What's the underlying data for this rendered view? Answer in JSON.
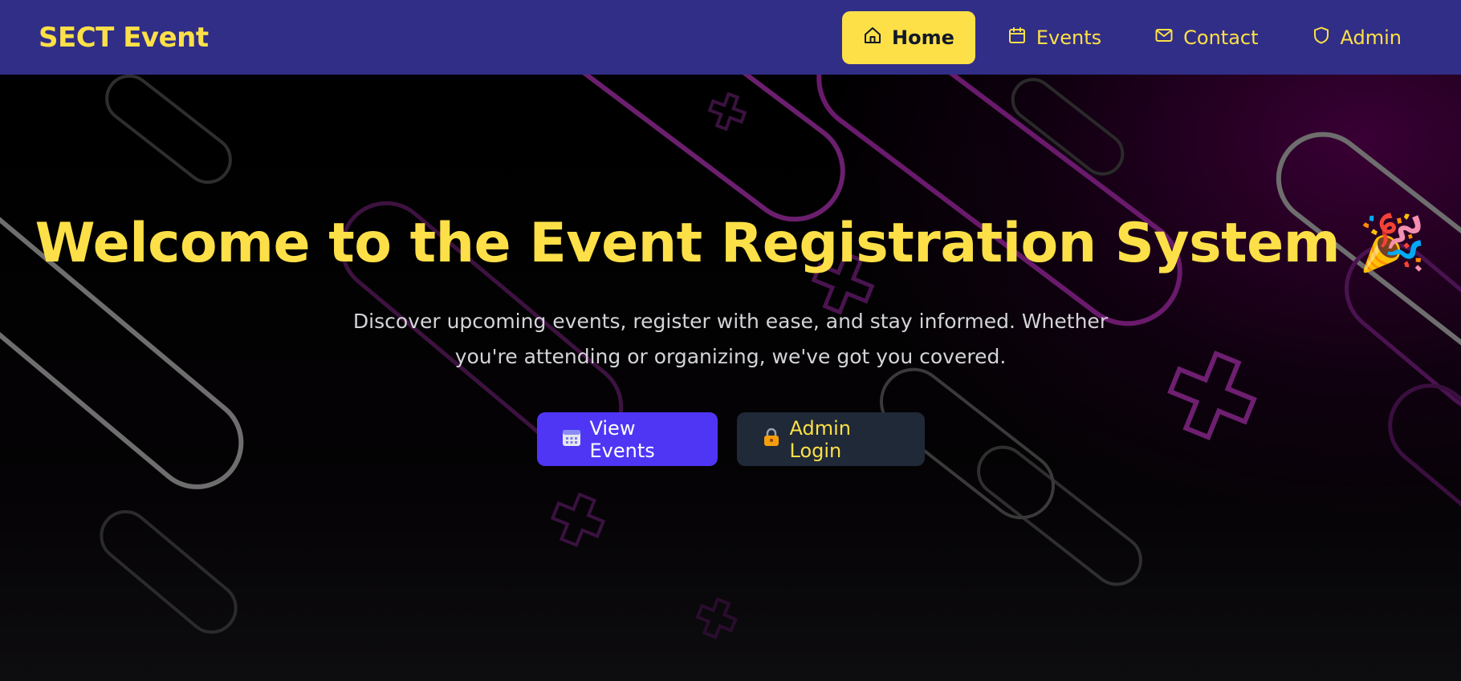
{
  "brand": "SECT Event",
  "nav": {
    "home": "Home",
    "events": "Events",
    "contact": "Contact",
    "admin": "Admin"
  },
  "hero": {
    "title": "Welcome to the Event Registration System",
    "title_emoji": "🎉",
    "subtitle": "Discover upcoming events, register with ease, and stay informed. Whether you're attending or organizing, we've got you covered.",
    "primary_button": "View Events",
    "secondary_button": "Admin Login"
  },
  "icons": {
    "home": "home-icon",
    "events": "calendar-icon",
    "contact": "mail-icon",
    "admin": "shield-icon",
    "view_events": "calendar-emoji-icon",
    "admin_login": "lock-emoji-icon"
  },
  "colors": {
    "navbar": "#312e87",
    "accent_yellow": "#fde047",
    "primary_button": "#4f36f5",
    "secondary_button": "#1f2937"
  }
}
